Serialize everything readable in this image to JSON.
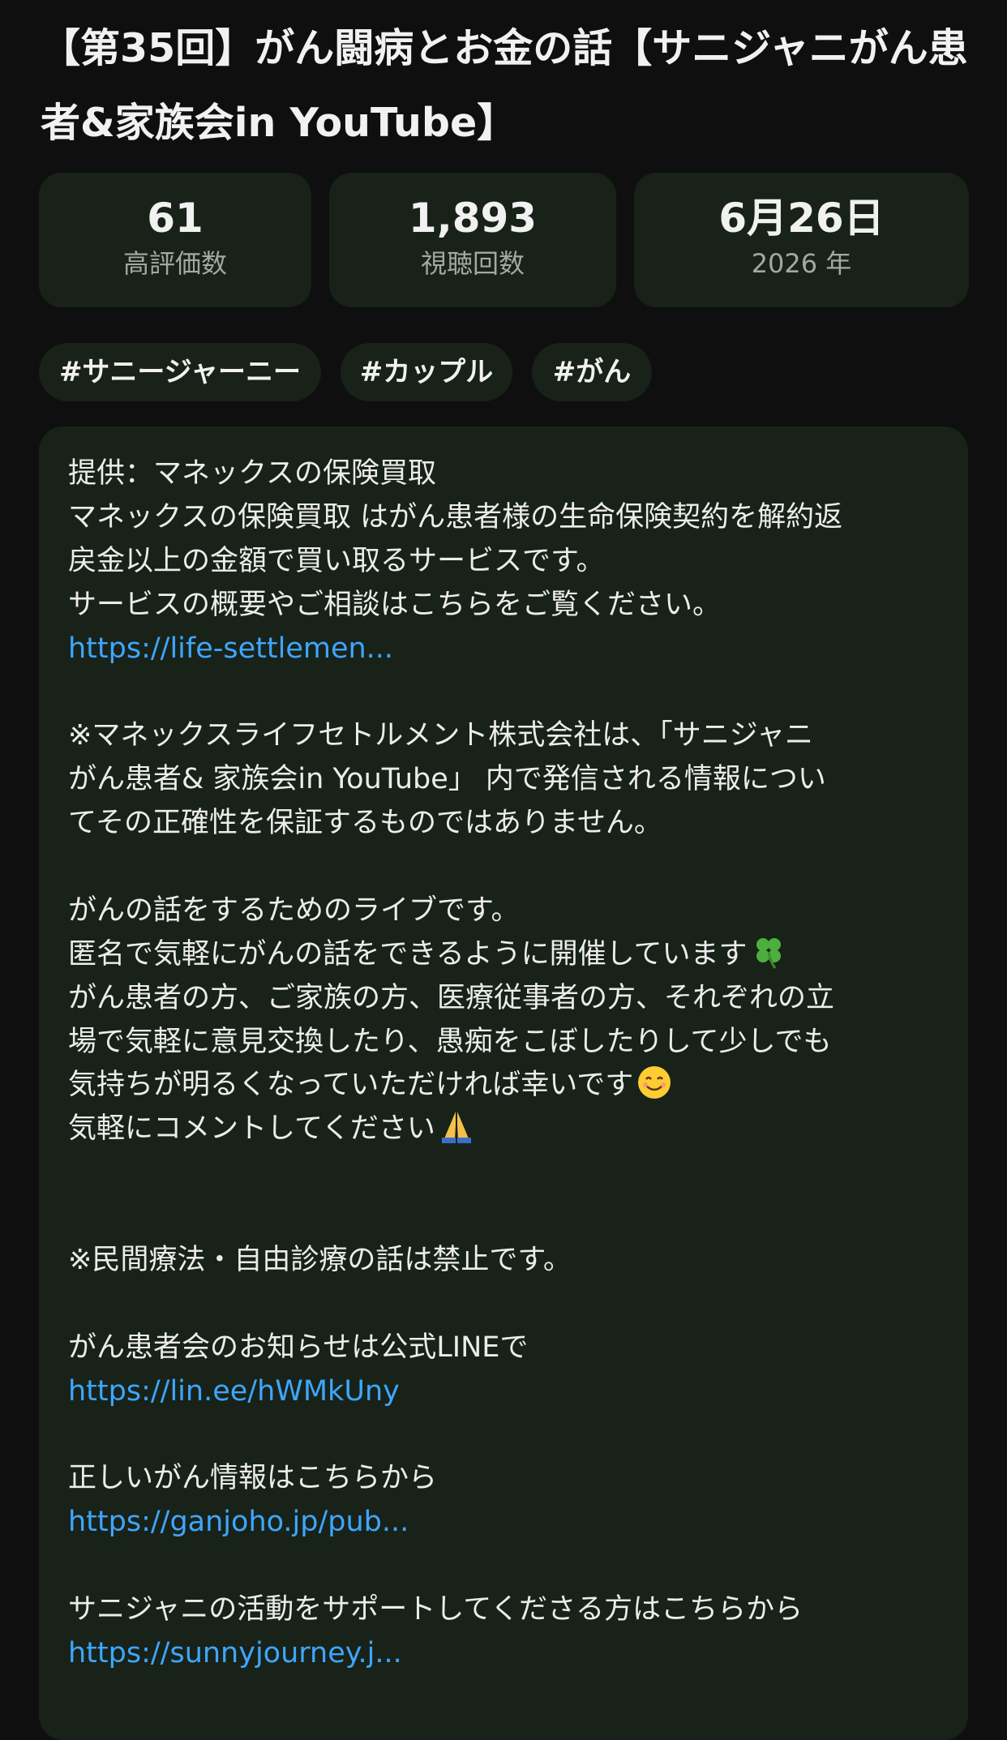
{
  "video": {
    "title": "【第35回】がん闘病とお金の話【サニジャニがん患者&家族会in YouTube】"
  },
  "stats": {
    "likes": {
      "value": "61",
      "label": "高評価数"
    },
    "views": {
      "value": "1,893",
      "label": "視聴回数"
    },
    "date": {
      "value": "6月26日",
      "label": "2026 年"
    }
  },
  "hashtags": [
    "#サニージャーニー",
    "#カップル",
    "#がん"
  ],
  "description": {
    "p1_l1": "提供：マネックスの保険買取",
    "p1_l2": "マネックスの保険買取 はがん患者様の生命保険契約を解約返",
    "p1_l3": "戻金以上の金額で買い取るサービスです。",
    "p1_l4": "サービスの概要やご相談はこちらをご覧ください。",
    "link_life": "https://life-settlemen...",
    "p2_l1": "※マネックスライフセトルメント株式会社は、「サニジャニ",
    "p2_l2": "がん患者& 家族会in YouTube」 内で発信される情報につい",
    "p2_l3": "てその正確性を保証するものではありません。",
    "p3_l1": "がんの話をするためのライブです。",
    "p3_l2": "匿名で気軽にがんの話をできるように開催しています",
    "p3_l3": "がん患者の方、ご家族の方、医療従事者の方、それぞれの立",
    "p3_l4": "場で気軽に意見交換したり、愚痴をこぼしたりして少しでも",
    "p3_l5": "気持ちが明るくなっていただければ幸いです",
    "p3_l6": "気軽にコメントしてください",
    "p4_l1": "※民間療法・自由診療の話は禁止です。",
    "p5_l1": "がん患者会のお知らせは公式LINEで",
    "link_line": "https://lin.ee/hWMkUny",
    "p6_l1": "正しいがん情報はこちらから",
    "link_ganjoho": "https://ganjoho.jp/pub...",
    "p7_l1": "サニジャニの活動をサポートしてくださる方はこちらから",
    "link_sunny": "https://sunnyjourney.j..."
  },
  "icons": {
    "clover": "four-leaf-clover-icon",
    "smile": "smiling-face-icon",
    "pray": "folded-hands-icon"
  },
  "colors": {
    "background": "#0f0f0f",
    "card": "#182218",
    "link": "#3ea6ff",
    "secondary_text": "#a3a8a3"
  }
}
